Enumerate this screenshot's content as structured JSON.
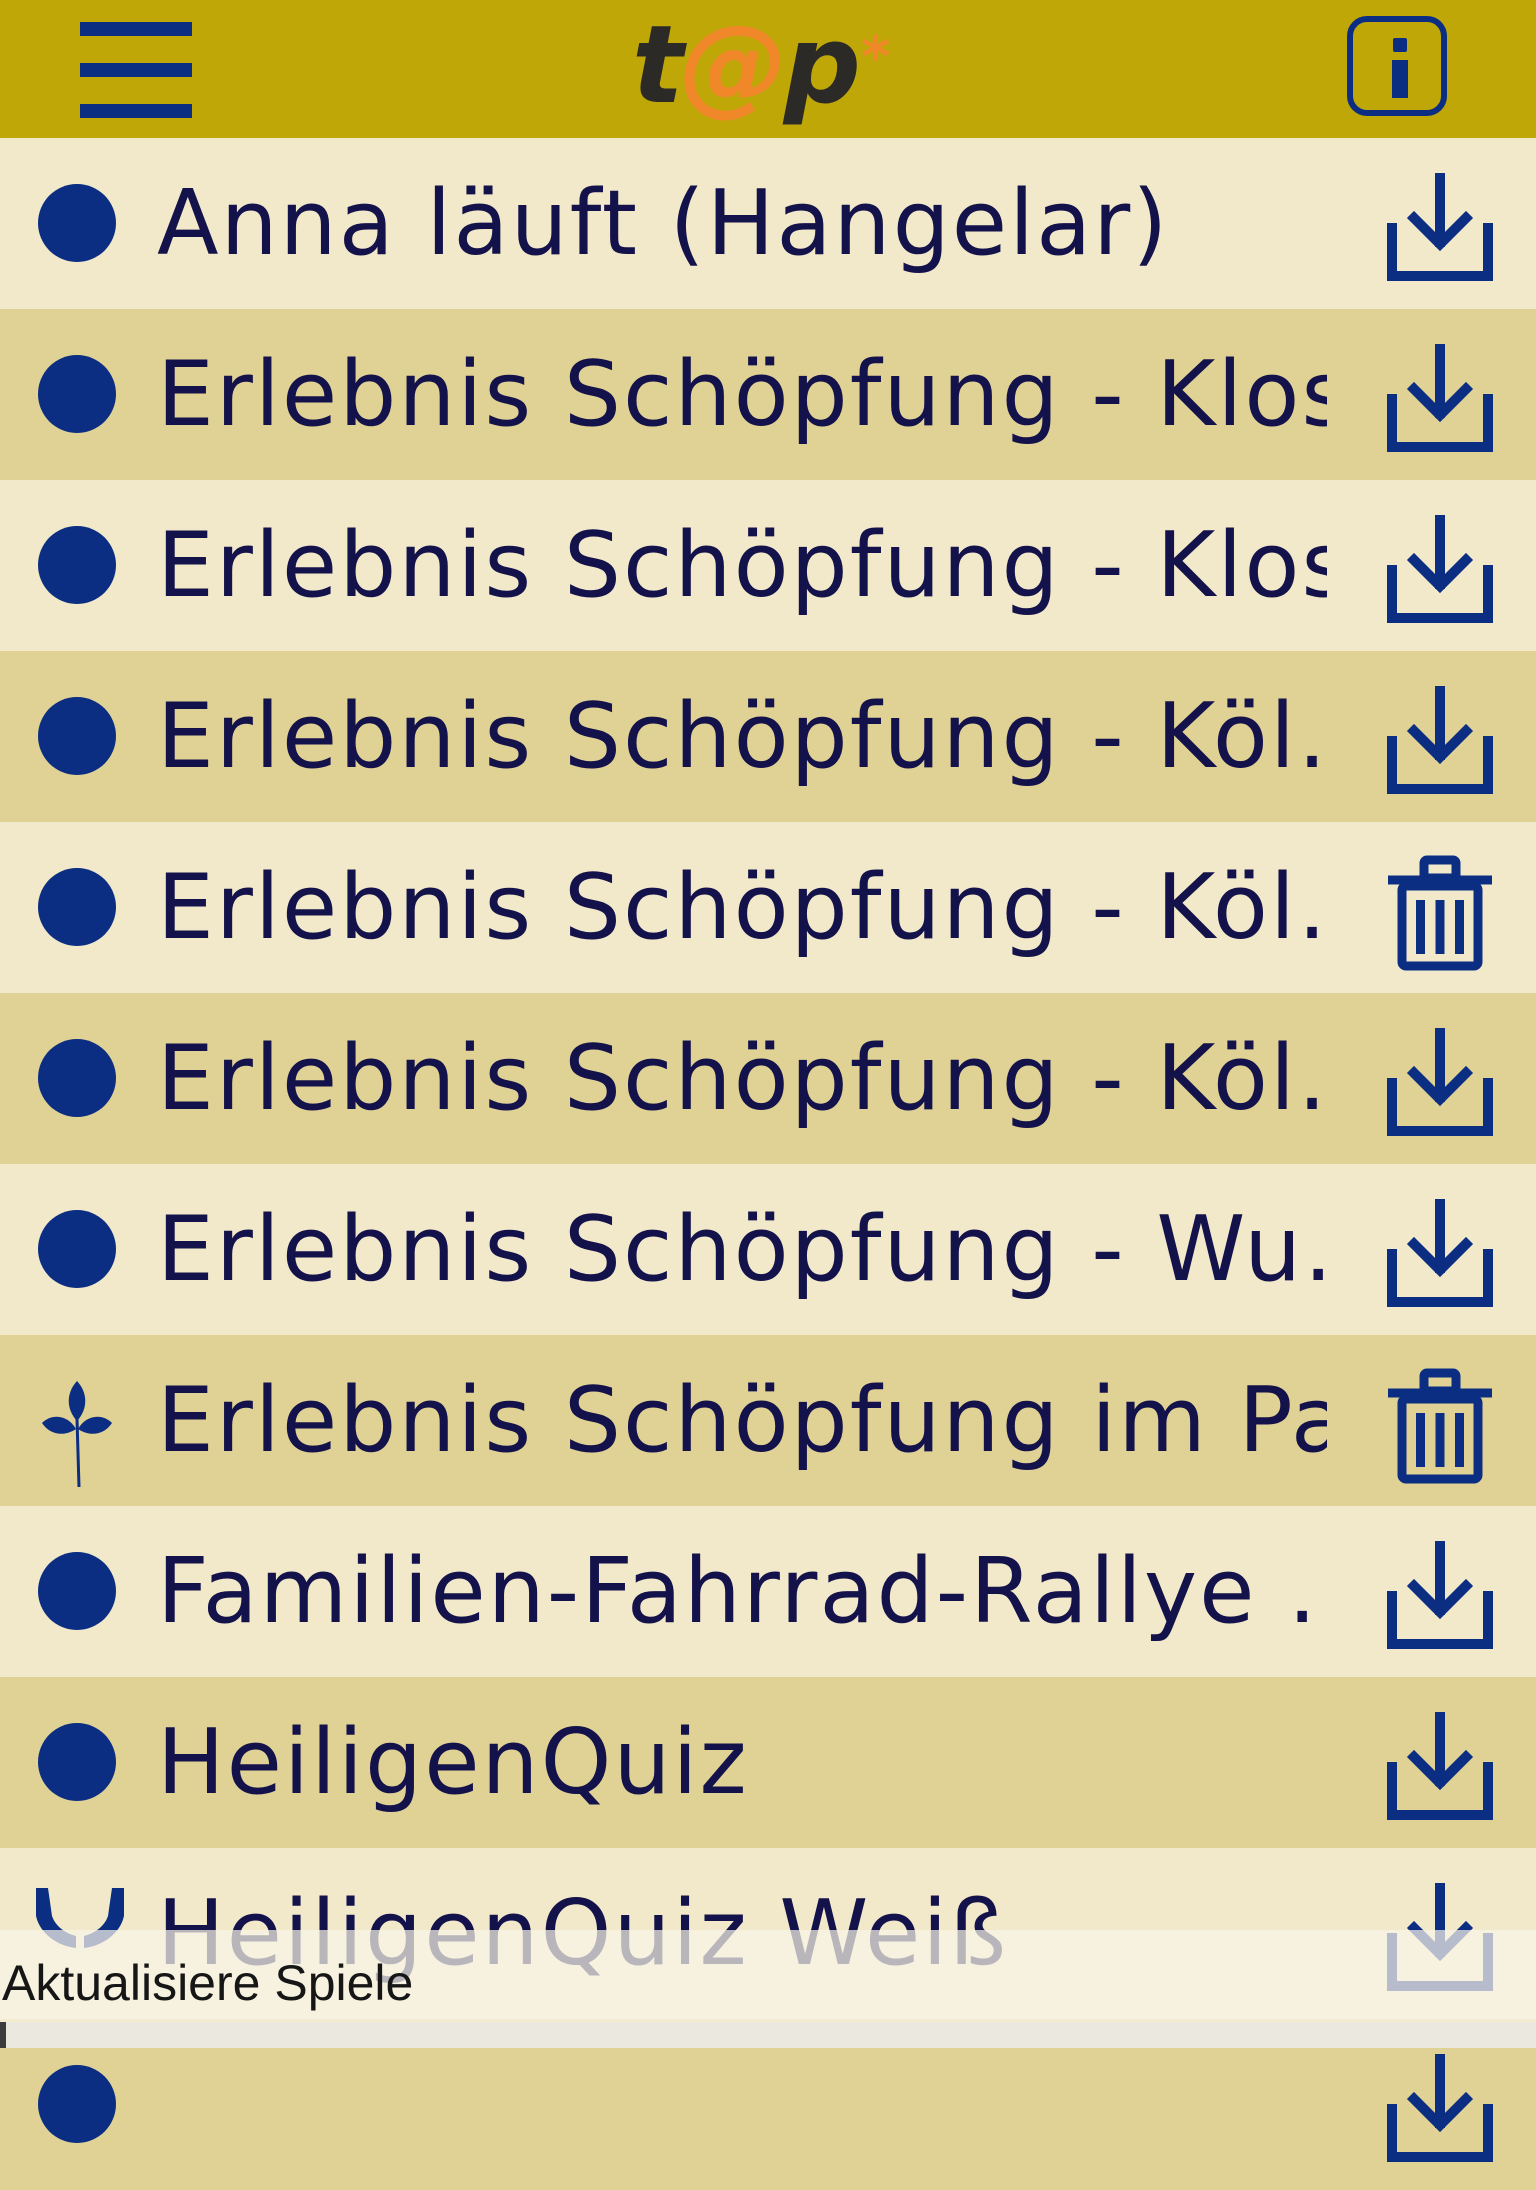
{
  "header": {
    "logo": {
      "t": "t",
      "at": "@",
      "p": "p",
      "star": "*"
    },
    "menu_icon": "hamburger-menu-icon",
    "info_icon": "info-icon"
  },
  "colors": {
    "header_bg": "#c0a708",
    "row_light": "#f2e9cb",
    "row_dark": "#e0d295",
    "accent_blue": "#0b2e83",
    "logo_orange": "#f0882a"
  },
  "games": [
    {
      "title": "Anna läuft (Hangelar)",
      "lead_icon": "circle-icon",
      "action": "download-icon"
    },
    {
      "title": "Erlebnis Schöpfung - Klos…",
      "lead_icon": "circle-icon",
      "action": "download-icon"
    },
    {
      "title": "Erlebnis Schöpfung - Klos…",
      "lead_icon": "circle-icon",
      "action": "download-icon"
    },
    {
      "title": "Erlebnis Schöpfung - Köl…",
      "lead_icon": "circle-icon",
      "action": "download-icon"
    },
    {
      "title": "Erlebnis Schöpfung - Köl…",
      "lead_icon": "circle-icon",
      "action": "trash-icon"
    },
    {
      "title": "Erlebnis Schöpfung - Köl…",
      "lead_icon": "circle-icon",
      "action": "download-icon"
    },
    {
      "title": "Erlebnis Schöpfung - Wu…",
      "lead_icon": "circle-icon",
      "action": "download-icon"
    },
    {
      "title": "Erlebnis Schöpfung im Pa…",
      "lead_icon": "leaf-icon",
      "action": "trash-icon"
    },
    {
      "title": "Familien-Fahrrad-Rallye …",
      "lead_icon": "circle-icon",
      "action": "download-icon"
    },
    {
      "title": "HeiligenQuiz",
      "lead_icon": "circle-icon",
      "action": "download-icon"
    },
    {
      "title": "HeiligenQuiz Weiß",
      "lead_icon": "hands-icon",
      "action": "download-icon"
    },
    {
      "title": "",
      "lead_icon": "circle-icon",
      "action": "download-icon"
    }
  ],
  "status": {
    "text": "Aktualisiere Spiele",
    "progress": 0.004
  }
}
